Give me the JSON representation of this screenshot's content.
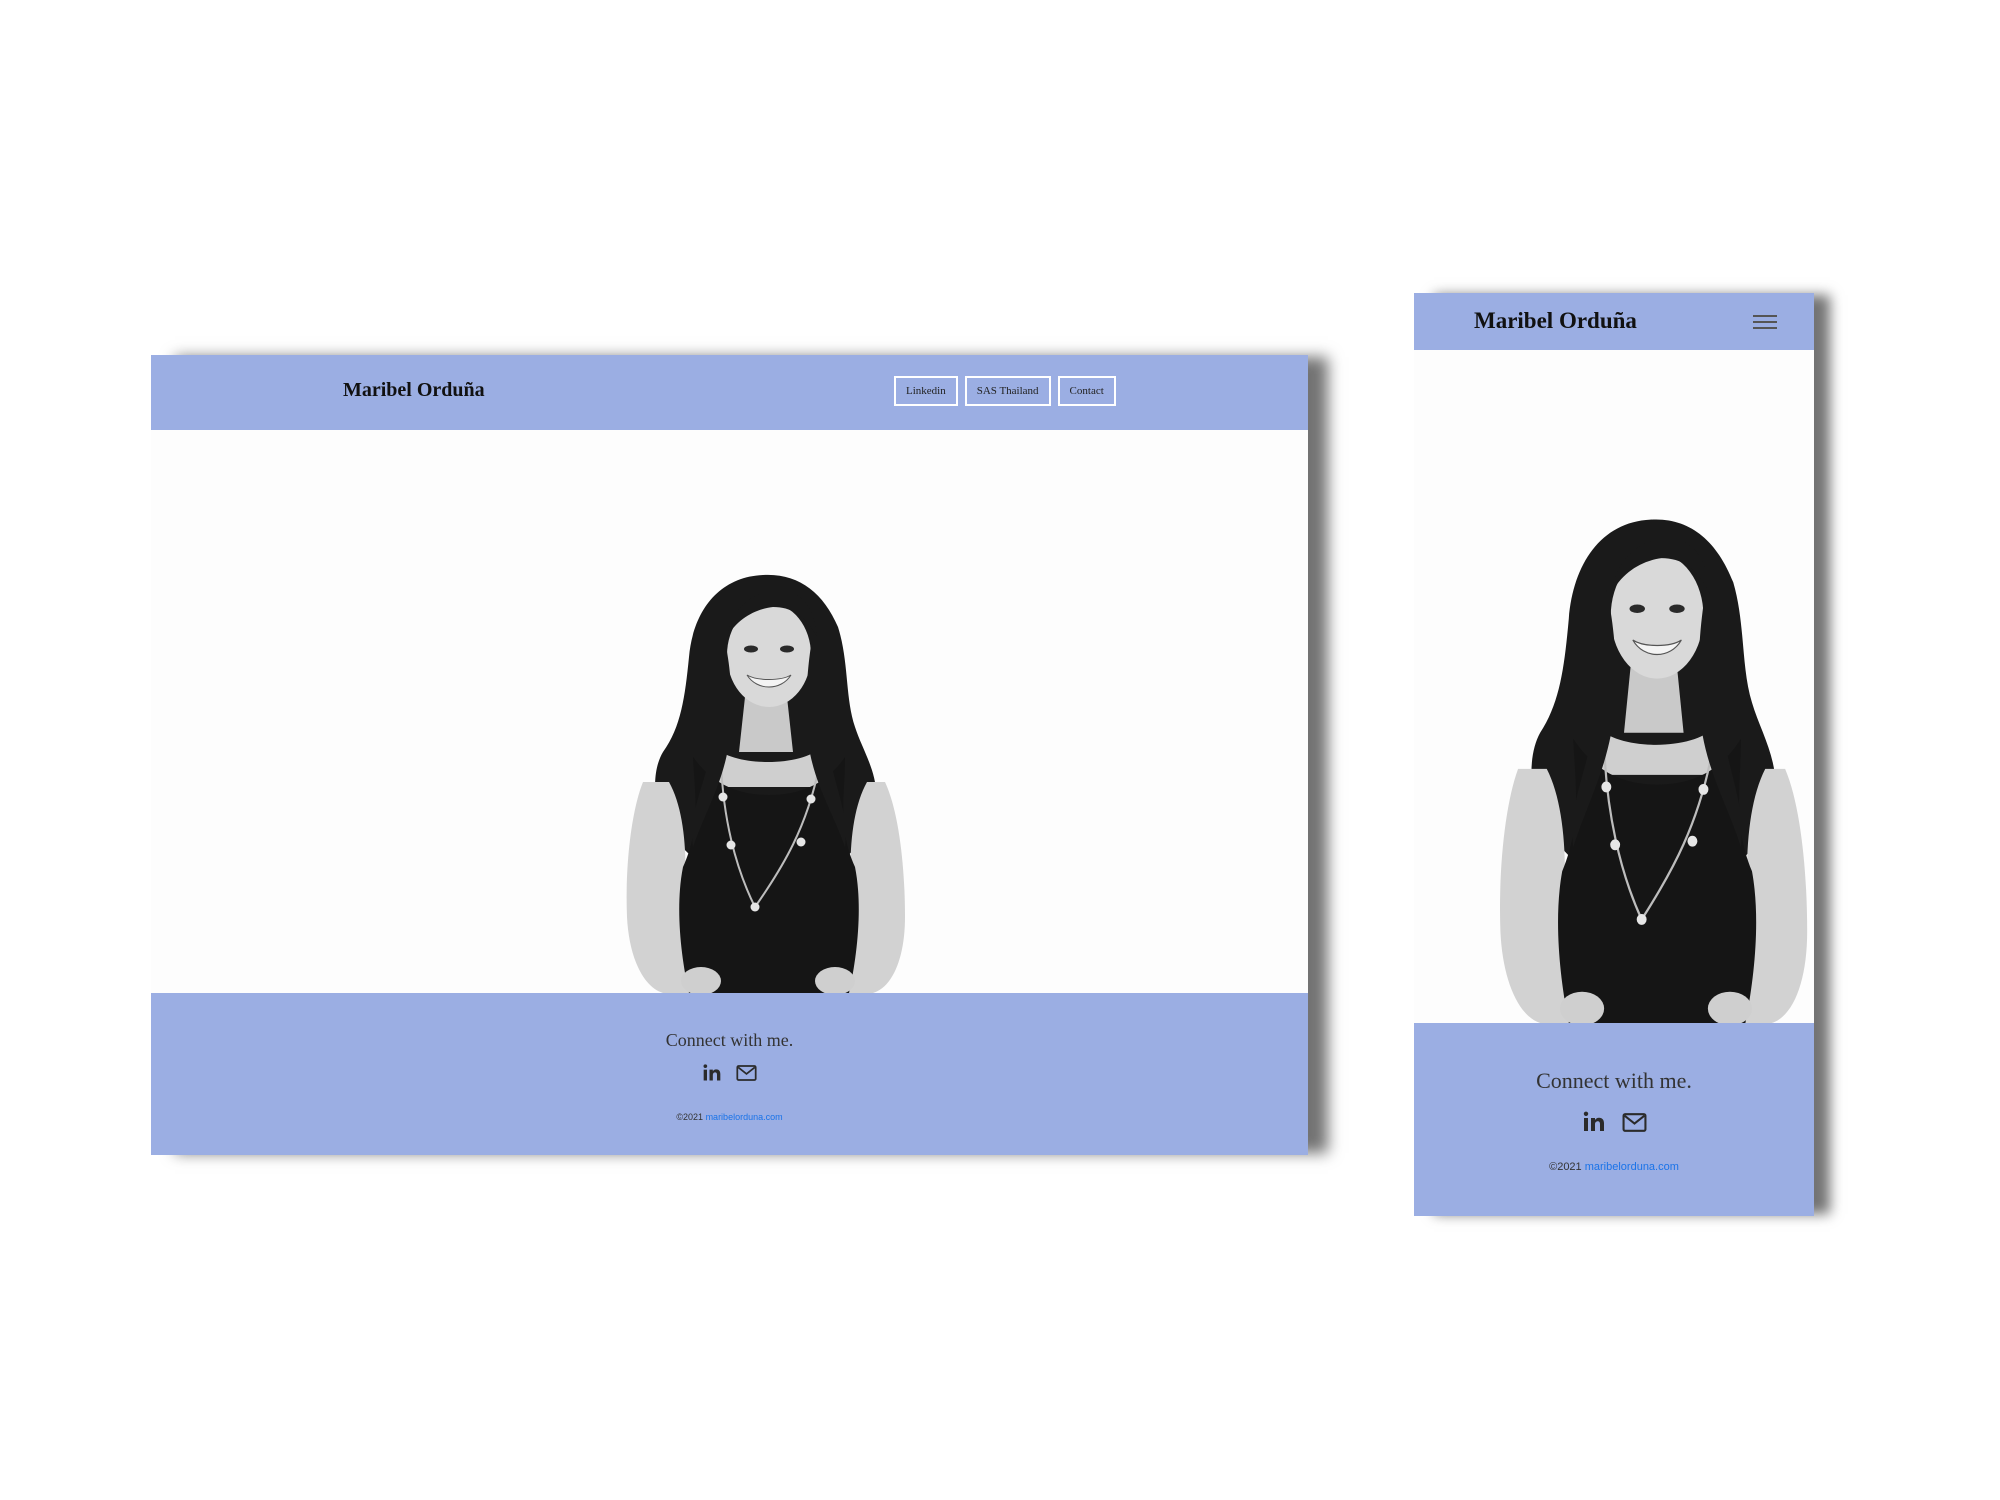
{
  "brand_name": "Maribel Orduña",
  "nav": {
    "items": [
      {
        "label": "Linkedin"
      },
      {
        "label": "SAS Thailand"
      },
      {
        "label": "Contact"
      }
    ]
  },
  "footer": {
    "connect_text": "Connect with me.",
    "copyright": "©2021",
    "site_link": "maribelorduna.com"
  },
  "icons": {
    "linkedin": "linkedin-icon",
    "email": "mail-icon",
    "menu": "hamburger-menu-icon"
  },
  "colors": {
    "accent": "#9baee3",
    "link": "#1a73e8",
    "text": "#111111"
  }
}
